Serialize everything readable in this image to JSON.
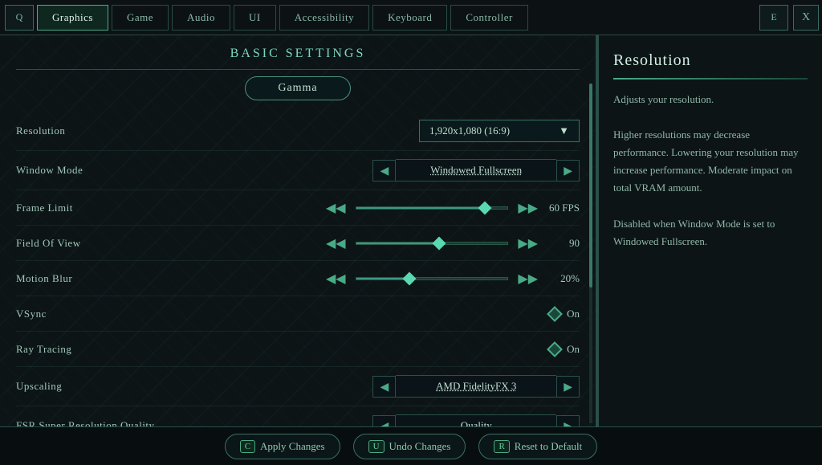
{
  "nav": {
    "icon_q": "Q",
    "icon_e": "E",
    "icon_x": "X",
    "tabs": [
      {
        "id": "graphics",
        "label": "Graphics",
        "active": true
      },
      {
        "id": "game",
        "label": "Game",
        "active": false
      },
      {
        "id": "audio",
        "label": "Audio",
        "active": false
      },
      {
        "id": "ui",
        "label": "UI",
        "active": false
      },
      {
        "id": "accessibility",
        "label": "Accessibility",
        "active": false
      },
      {
        "id": "keyboard",
        "label": "Keyboard",
        "active": false
      },
      {
        "id": "controller",
        "label": "Controller",
        "active": false
      }
    ]
  },
  "main": {
    "section_title": "Basic Settings",
    "gamma_btn": "Gamma",
    "settings": [
      {
        "id": "resolution",
        "label": "Resolution",
        "type": "dropdown",
        "value": "1,920x1,080 (16:9)"
      },
      {
        "id": "window_mode",
        "label": "Window Mode",
        "type": "arrow_selector",
        "value": "Windowed Fullscreen"
      },
      {
        "id": "frame_limit",
        "label": "Frame Limit",
        "type": "slider",
        "value": "60 FPS",
        "fill_pct": 85
      },
      {
        "id": "field_of_view",
        "label": "Field Of View",
        "type": "slider",
        "value": "90",
        "fill_pct": 55
      },
      {
        "id": "motion_blur",
        "label": "Motion Blur",
        "type": "slider",
        "value": "20%",
        "fill_pct": 35
      },
      {
        "id": "vsync",
        "label": "VSync",
        "type": "toggle",
        "value": "On"
      },
      {
        "id": "ray_tracing",
        "label": "Ray Tracing",
        "type": "toggle",
        "value": "On"
      },
      {
        "id": "upscaling",
        "label": "Upscaling",
        "type": "arrow_selector",
        "value": "AMD FidelityFX 3"
      },
      {
        "id": "fsr_quality",
        "label": "FSR Super Resolution Quality",
        "type": "arrow_selector",
        "value": "Quality"
      }
    ]
  },
  "right_panel": {
    "title": "Resolution",
    "text": "Adjusts your resolution.\n\nHigher resolutions may decrease performance. Lowering your resolution may increase performance. Moderate impact on total VRAM amount.\n\nDisabled when Window Mode is set to Windowed Fullscreen."
  },
  "bottom": {
    "apply_key": "C",
    "apply_label": "Apply Changes",
    "undo_key": "U",
    "undo_label": "Undo Changes",
    "reset_key": "R",
    "reset_label": "Reset to Default"
  }
}
